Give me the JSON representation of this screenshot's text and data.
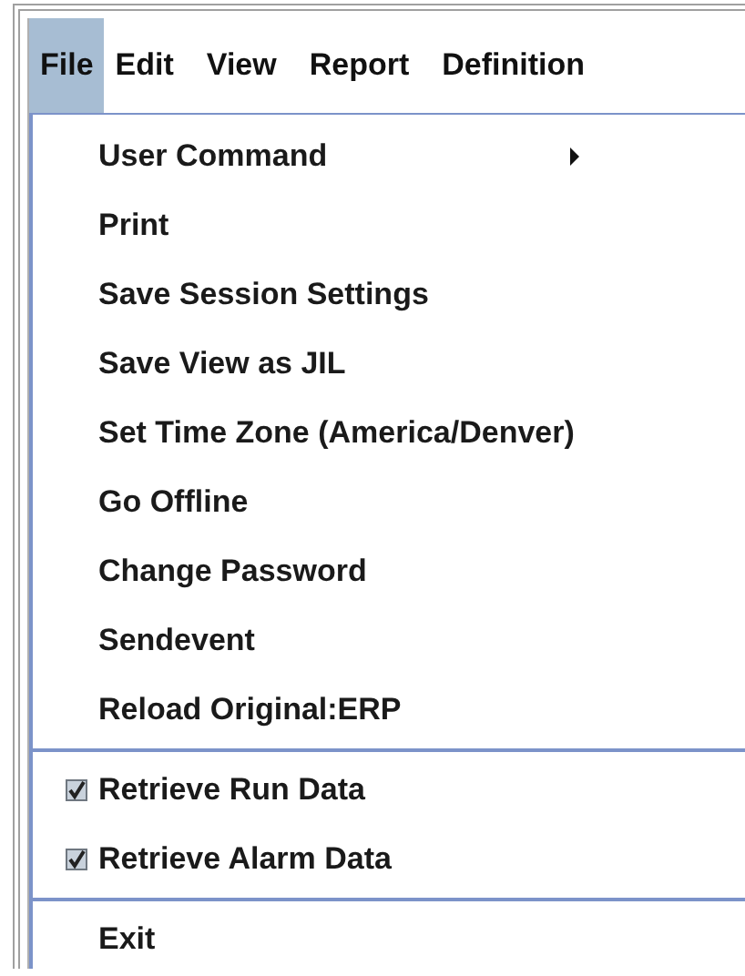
{
  "menubar": [
    {
      "label": "File",
      "selected": true
    },
    {
      "label": "Edit",
      "selected": false
    },
    {
      "label": "View",
      "selected": false
    },
    {
      "label": "Report",
      "selected": false
    },
    {
      "label": "Definition",
      "selected": false
    }
  ],
  "menu": [
    {
      "kind": "submenu",
      "label": "User Command"
    },
    {
      "kind": "command",
      "label": "Print"
    },
    {
      "kind": "command",
      "label": "Save Session Settings"
    },
    {
      "kind": "command",
      "label": "Save View as JIL"
    },
    {
      "kind": "command",
      "label": "Set Time Zone (America/Denver)"
    },
    {
      "kind": "command",
      "label": "Go Offline"
    },
    {
      "kind": "command",
      "label": "Change Password"
    },
    {
      "kind": "command",
      "label": "Sendevent"
    },
    {
      "kind": "command",
      "label": "Reload Original:ERP"
    },
    {
      "kind": "separator"
    },
    {
      "kind": "check",
      "label": "Retrieve Run Data",
      "checked": true
    },
    {
      "kind": "check",
      "label": "Retrieve Alarm Data",
      "checked": true
    },
    {
      "kind": "separator"
    },
    {
      "kind": "command",
      "label": "Exit"
    }
  ]
}
